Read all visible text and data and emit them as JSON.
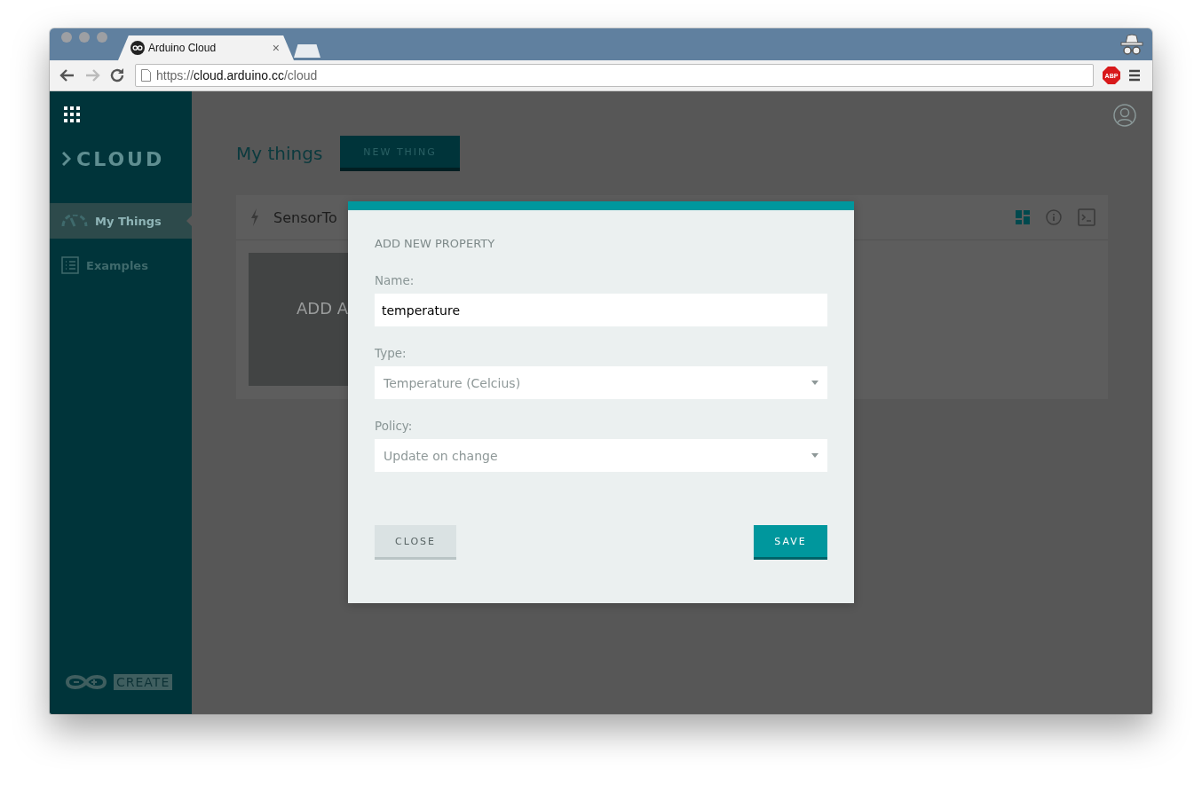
{
  "browser": {
    "tab_title": "Arduino Cloud",
    "tab_close": "×",
    "url_scheme": "https://",
    "url_host": "cloud.arduino.cc",
    "url_path": "/cloud",
    "adblock_badge": "ABP"
  },
  "sidebar": {
    "logo": "CLOUD",
    "items": [
      {
        "label": "My Things",
        "kind": "gauge",
        "selected": true
      },
      {
        "label": "Examples",
        "kind": "list",
        "selected": false
      }
    ],
    "footer_badge": "CREATE"
  },
  "main": {
    "title": "My things",
    "new_button": "NEW THING",
    "thing": {
      "name": "SensorTo",
      "add_tile": "ADD A"
    }
  },
  "dialog": {
    "title": "ADD NEW PROPERTY",
    "fields": [
      {
        "label": "Name:",
        "kind": "text",
        "value": "temperature"
      },
      {
        "label": "Type:",
        "kind": "select",
        "value": "Temperature (Celcius)"
      },
      {
        "label": "Policy:",
        "kind": "select",
        "value": "Update on change"
      }
    ],
    "close_button": "CLOSE",
    "save_button": "SAVE"
  }
}
